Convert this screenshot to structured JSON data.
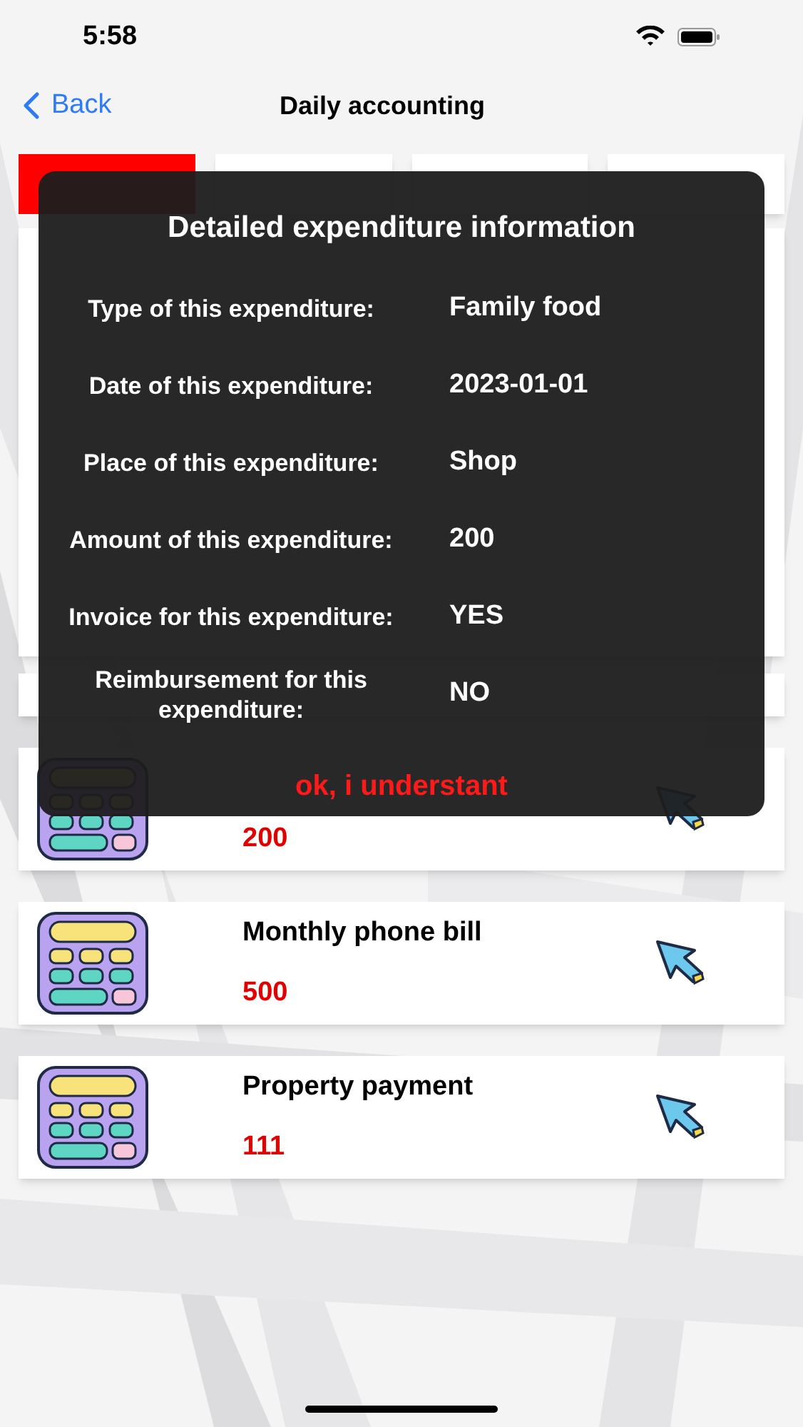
{
  "status_bar": {
    "time": "5:58"
  },
  "nav": {
    "back": "Back",
    "title": "Daily accounting"
  },
  "tabs": [
    {
      "selected": true
    },
    {
      "selected": false
    },
    {
      "selected": false
    },
    {
      "selected": false
    }
  ],
  "dialog": {
    "title": "Detailed expenditure information",
    "rows": [
      {
        "label": "Type of this expenditure:",
        "value": "Family food"
      },
      {
        "label": "Date of this expenditure:",
        "value": "2023-01-01"
      },
      {
        "label": "Place of this expenditure:",
        "value": "Shop"
      },
      {
        "label": "Amount of this expenditure:",
        "value": "200"
      },
      {
        "label": "Invoice for this expenditure:",
        "value": "YES"
      },
      {
        "label": "Reimbursement for this expenditure:",
        "value": "NO"
      }
    ],
    "button": "ok, i understant"
  },
  "expenses": [
    {
      "amount": "200"
    },
    {
      "title": "Monthly phone bill",
      "amount": "500"
    },
    {
      "title": "Property payment",
      "amount": "111"
    }
  ]
}
